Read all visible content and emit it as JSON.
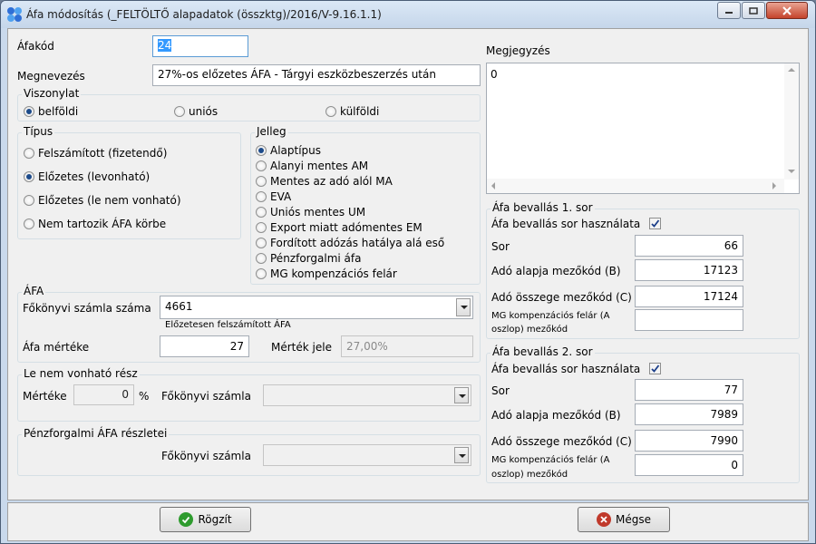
{
  "window": {
    "title": "Áfa módosítás (_FELTÖLTŐ alapadatok (összktg)/2016/V-9.16.1.1)"
  },
  "form": {
    "afakod_label": "Áfakód",
    "afakod_value": "24",
    "megnevezes_label": "Megnevezés",
    "megnevezes_value": "27%-os előzetes ÁFA - Tárgyi eszközbeszerzés után",
    "megjegyzes_label": "Megjegyzés",
    "megjegyzes_value": "0"
  },
  "viszonylat": {
    "title": "Viszonylat",
    "options": [
      "belföldi",
      "uniós",
      "külföldi"
    ],
    "selected": "belföldi"
  },
  "tipus": {
    "title": "Típus",
    "options": [
      "Felszámított (fizetendő)",
      "Előzetes (levonható)",
      "Előzetes (le nem vonható)",
      "Nem tartozik ÁFA körbe"
    ],
    "selected": "Előzetes (levonható)"
  },
  "jelleg": {
    "title": "Jelleg",
    "options": [
      "Alaptípus",
      "Alanyi mentes AM",
      "Mentes az adó alól  MA",
      "EVA",
      "Uniós mentes UM",
      "Export miatt adómentes EM",
      "Fordított adózás hatálya alá eső",
      "Pénzforgalmi áfa",
      "MG kompenzációs felár"
    ],
    "selected": "Alaptípus"
  },
  "afa": {
    "title": "ÁFA",
    "fokonyvi_label": "Főkönyvi számla száma",
    "fokonyvi_value": "4661",
    "fokonyvi_desc": "Előzetesen felszámított ÁFA",
    "mertek_label": "Áfa mértéke",
    "mertek_value": "27",
    "mertek_jele_label": "Mérték jele",
    "mertek_jele_value": "27,00%"
  },
  "lenem": {
    "title": "Le nem vonható rész",
    "merteke_label": "Mértéke",
    "merteke_value": "0",
    "percent": "%",
    "fokonyvi_label": "Főkönyvi számla",
    "fokonyvi_value": ""
  },
  "penzforgalmi": {
    "title": "Pénzforgalmi ÁFA részletei",
    "fokonyvi_label": "Főkönyvi számla",
    "fokonyvi_value": ""
  },
  "bevallas1": {
    "title": "Áfa bevallás 1. sor",
    "hasznalata_label": "Áfa bevallás sor használata",
    "hasznalata_checked": true,
    "sor_label": "Sor",
    "sor_value": "66",
    "alap_label": "Adó alapja mezőkód (B)",
    "alap_value": "17123",
    "osszeg_label": "Adó összege mezőkód (C)",
    "osszeg_value": "17124",
    "mg_label_1": "MG kompenzációs felár (A",
    "mg_label_2": "oszlop) mezőkód",
    "mg_value": ""
  },
  "bevallas2": {
    "title": "Áfa bevallás 2. sor",
    "hasznalata_label": "Áfa bevallás sor használata",
    "hasznalata_checked": true,
    "sor_label": "Sor",
    "sor_value": "77",
    "alap_label": "Adó alapja mezőkód (B)",
    "alap_value": "7989",
    "osszeg_label": "Adó összege mezőkód (C)",
    "osszeg_value": "7990",
    "mg_label_1": "MG kompenzációs felár (A",
    "mg_label_2": "oszlop) mezőkód",
    "mg_value": "0"
  },
  "buttons": {
    "save_label": "Rögzít",
    "cancel_label": "Mégse"
  },
  "colors": {
    "save_icon": "#2e9b2e",
    "cancel_icon": "#c0392b",
    "selection": "#3399ff"
  }
}
